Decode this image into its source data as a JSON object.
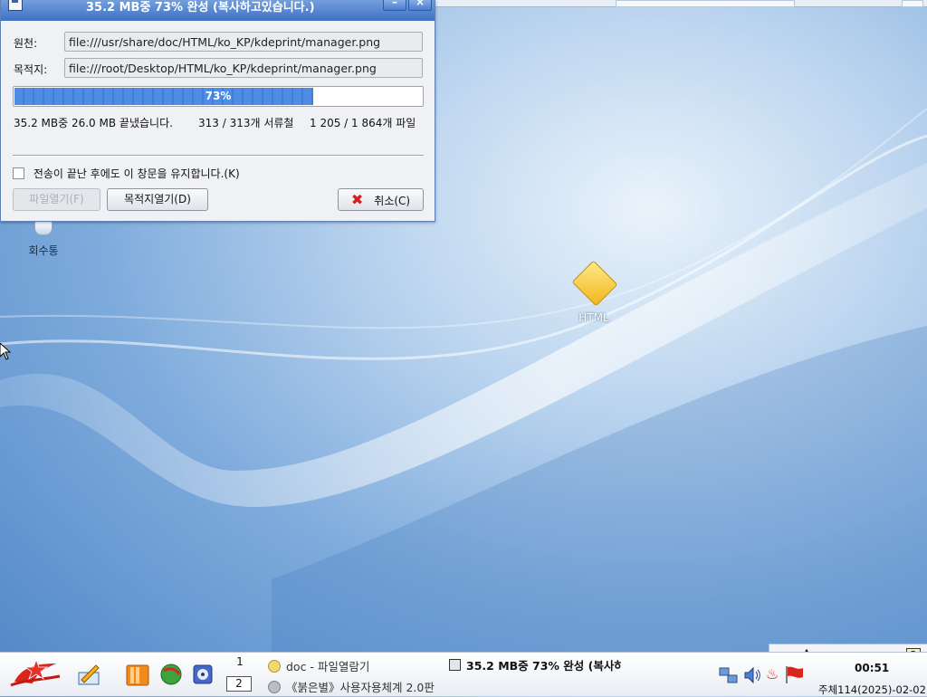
{
  "dialog": {
    "title": "35.2 MB중 73% 완성 (복사하고있습니다.)",
    "source_label": "원천:",
    "source_value": "file:///usr/share/doc/HTML/ko_KP/kdeprint/manager.png",
    "dest_label": "목적지:",
    "dest_value": "file:///root/Desktop/HTML/ko_KP/kdeprint/manager.png",
    "progress_text": "73%",
    "progress_fraction": 0.73,
    "stats_size": "35.2 MB중 26.0 MB 끝냈습니다.",
    "stats_dirs": "313 / 313개 서류철",
    "stats_files": "1 205 / 1 864개 파일",
    "keep_window_label": "전송이 끝난 후에도 이 창문을 유지합니다.(K)",
    "keep_window_checked": false,
    "open_file_label": "파일열기(F)",
    "open_dest_label": "목적지열기(D)",
    "cancel_label": "취소(C)"
  },
  "desktop": {
    "trash_label": "회수통",
    "folder_label": "HTML"
  },
  "taskbar": {
    "pager_1": "1",
    "pager_2": "2",
    "task_1": "doc - 파일열람기",
    "task_2": "《붉은별》사용자용체계 2.0판",
    "active_task": "35.2 MB중 73% 완성 (복사하",
    "tray_icons": [
      "fire-icon",
      "font-icon",
      "window-split-icon",
      "note-icon",
      "tools-icon",
      "clipboard-icon",
      "help-icon"
    ],
    "time": "00:51",
    "date": "주체114(2025)-02-02"
  },
  "colors": {
    "title_bar": "#3e71c4",
    "progress_fill": "#4f8de5",
    "cancel_icon": "#d21f1f"
  }
}
